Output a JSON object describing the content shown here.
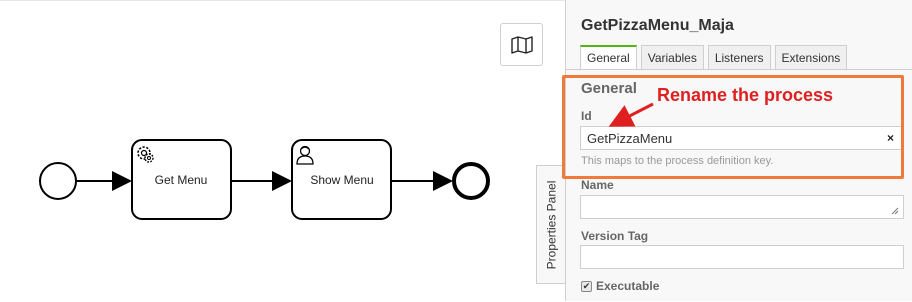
{
  "diagram": {
    "tasks": [
      {
        "label": "Get Menu",
        "icon": "gear-icon"
      },
      {
        "label": "Show Menu",
        "icon": "user-icon"
      }
    ]
  },
  "minimap": {
    "icon": "map-icon"
  },
  "properties_tab": {
    "label": "Properties Panel"
  },
  "panel": {
    "title": "GetPizzaMenu_Maja",
    "tabs": [
      {
        "label": "General",
        "active": true
      },
      {
        "label": "Variables"
      },
      {
        "label": "Listeners"
      },
      {
        "label": "Extensions"
      }
    ],
    "group_title": "General",
    "id_field": {
      "label": "Id",
      "value": "GetPizzaMenu",
      "clear": "×",
      "hint": "This maps to the process definition key."
    },
    "name_field": {
      "label": "Name",
      "value": ""
    },
    "version_field": {
      "label": "Version Tag",
      "value": ""
    },
    "executable": {
      "label": "Executable",
      "checked": true,
      "mark": "✔"
    }
  },
  "annotation": {
    "text": "Rename the process",
    "colors": {
      "box": "#f07a3a",
      "text": "#e02020"
    }
  },
  "colors": {
    "accent_tab": "#52b415"
  }
}
